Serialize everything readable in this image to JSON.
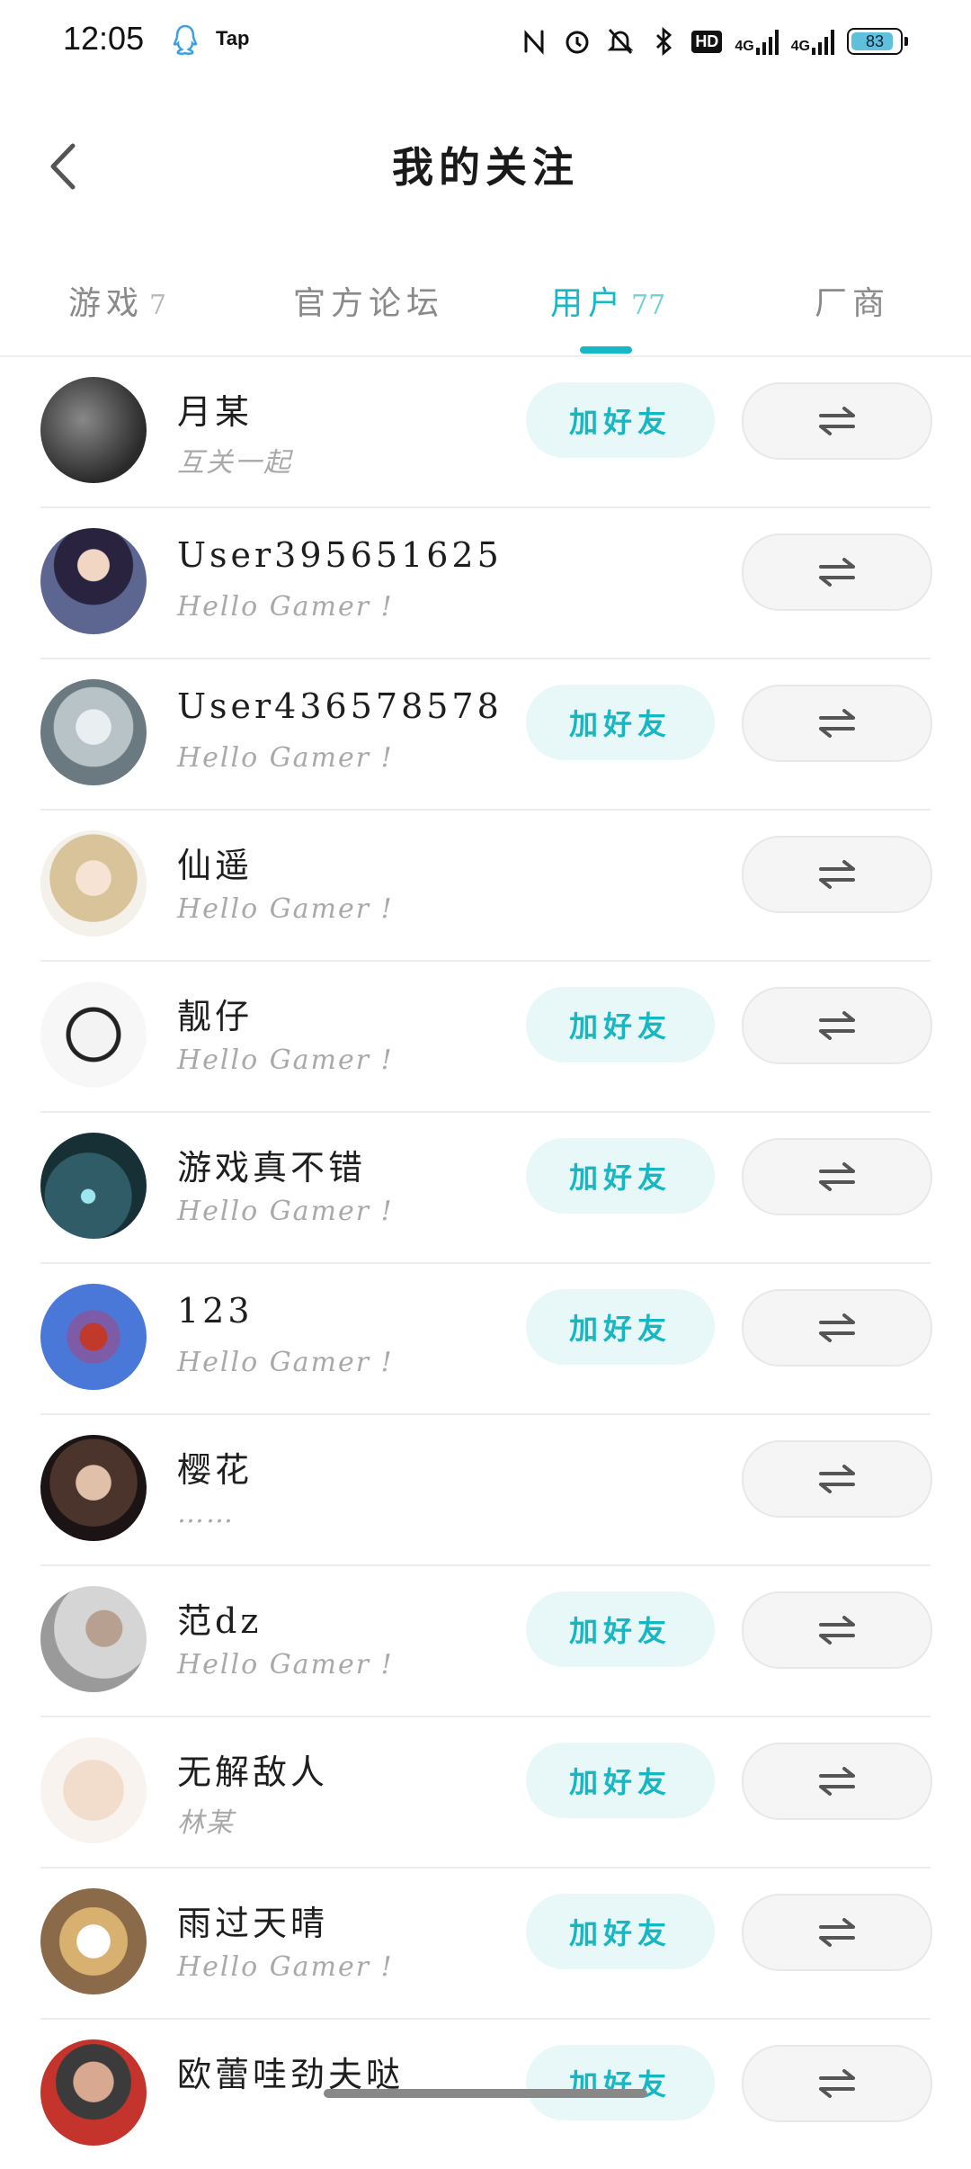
{
  "status_bar": {
    "time": "12:05",
    "app_label": "Tap",
    "network_label_1": "4G",
    "network_label_2": "4G",
    "hd_label": "HD",
    "battery": "83",
    "icons": [
      "qq-icon",
      "nfc-icon",
      "alarm-icon",
      "mute-bell-icon",
      "bluetooth-icon",
      "hd-icon",
      "signal-icon",
      "signal-icon",
      "battery-icon"
    ]
  },
  "header": {
    "title": "我的关注",
    "back_icon": "chevron-left-icon"
  },
  "tabs": [
    {
      "label": "游戏",
      "count": "7",
      "active": false
    },
    {
      "label": "官方论坛",
      "count": "",
      "active": false
    },
    {
      "label": "用户",
      "count": "77",
      "active": true
    },
    {
      "label": "厂商",
      "count": "",
      "active": false
    }
  ],
  "colors": {
    "accent": "#15b8c6",
    "add_friend_bg": "#e8f8f9",
    "mutual_bg": "#f5f5f5"
  },
  "users": [
    {
      "name": "月某",
      "sub": "互关一起",
      "add_friend": true
    },
    {
      "name": "User395651625",
      "sub": "Hello Gamer !",
      "add_friend": false
    },
    {
      "name": "User436578578",
      "sub": "Hello Gamer !",
      "add_friend": true
    },
    {
      "name": "仙遥",
      "sub": "Hello Gamer !",
      "add_friend": false
    },
    {
      "name": "靓仔",
      "sub": "Hello Gamer !",
      "add_friend": true
    },
    {
      "name": "游戏真不错",
      "sub": "Hello Gamer !",
      "add_friend": true
    },
    {
      "name": "123",
      "sub": "Hello Gamer !",
      "add_friend": true
    },
    {
      "name": "樱花",
      "sub": "……",
      "add_friend": false
    },
    {
      "name": "范dz",
      "sub": "Hello Gamer !",
      "add_friend": true
    },
    {
      "name": "无解敌人",
      "sub": "林某",
      "add_friend": true
    },
    {
      "name": "雨过天晴",
      "sub": "Hello Gamer !",
      "add_friend": true
    },
    {
      "name": "欧蕾哇劲夫哒",
      "sub": "",
      "add_friend": true
    }
  ],
  "buttons": {
    "add_friend_label": "加好友",
    "mutual_icon": "swap-arrows-icon"
  }
}
